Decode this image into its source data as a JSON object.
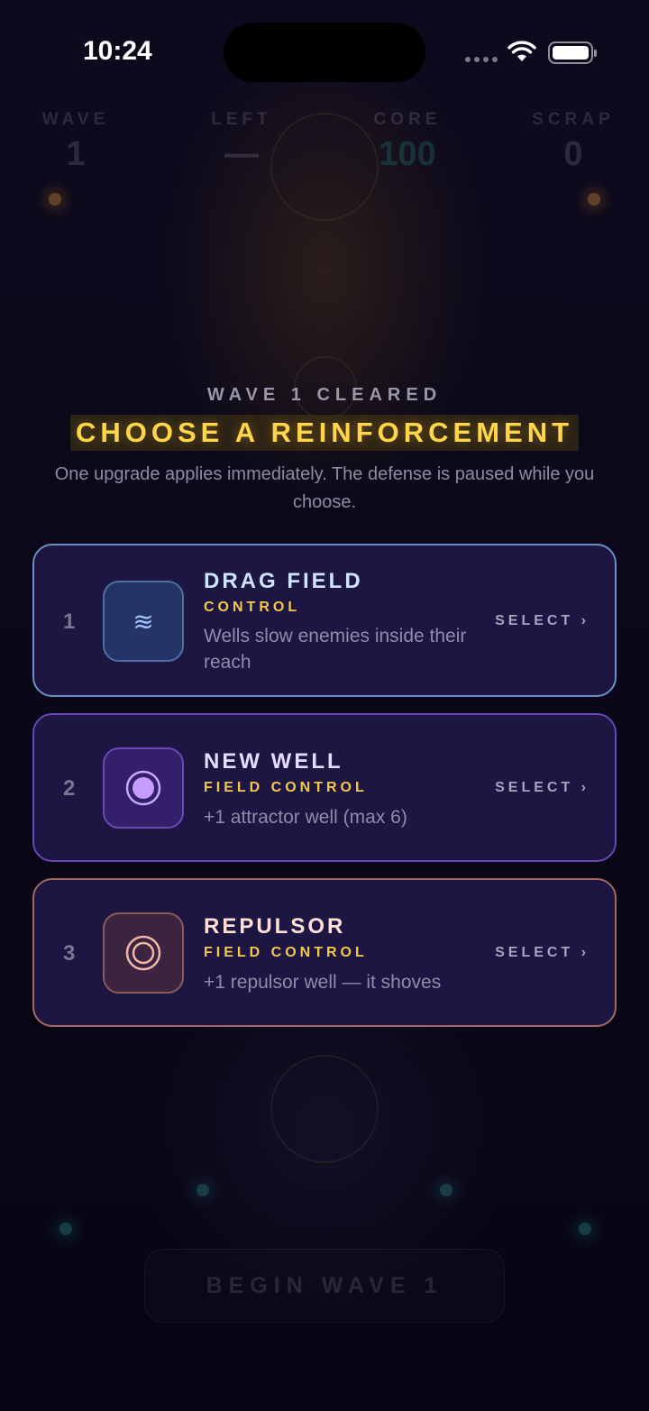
{
  "status_bar": {
    "time": "10:24"
  },
  "hud": {
    "wave": {
      "label": "WAVE",
      "value": "1"
    },
    "left": {
      "label": "LEFT",
      "value": "—"
    },
    "core": {
      "label": "CORE",
      "value": "100"
    },
    "scrap": {
      "label": "SCRAP",
      "value": "0"
    }
  },
  "overlay": {
    "subtitle": "WAVE 1 CLEARED",
    "title": "CHOOSE A REINFORCEMENT",
    "description": "One upgrade applies immediately. The defense is paused while you choose.",
    "cards": [
      {
        "number": "1",
        "name": "DRAG FIELD",
        "category": "CONTROL",
        "description": "Wells slow enemies inside their reach",
        "action": "SELECT ›",
        "icon": "wave-icon",
        "glyph": "≋"
      },
      {
        "number": "2",
        "name": "NEW WELL",
        "category": "FIELD CONTROL",
        "description": "+1 attractor well (max 6)",
        "action": "SELECT ›",
        "icon": "attractor-well-icon"
      },
      {
        "number": "3",
        "name": "REPULSOR",
        "category": "FIELD CONTROL",
        "description": "+1 repulsor well — it shoves",
        "action": "SELECT ›",
        "icon": "repulsor-well-icon"
      }
    ]
  },
  "begin_button": {
    "label": "BEGIN WAVE 1"
  },
  "colors": {
    "accent_gold": "#ffd54a",
    "card_bg": "#1e1642",
    "core_teal": "#34e0d4"
  }
}
